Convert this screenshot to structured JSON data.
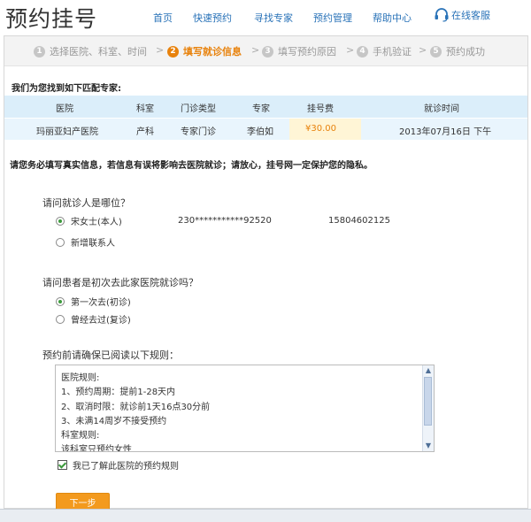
{
  "header": {
    "logo": "预约挂号",
    "nav": [
      "首页",
      "快速预约",
      "寻找专家",
      "预约管理",
      "帮助中心"
    ],
    "online": "在线客服"
  },
  "steps": [
    {
      "num": "1",
      "label": "选择医院、科室、时间"
    },
    {
      "num": "2",
      "label": "填写就诊信息"
    },
    {
      "num": "3",
      "label": "填写预约原因"
    },
    {
      "num": "4",
      "label": "手机验证"
    },
    {
      "num": "5",
      "label": "预约成功"
    }
  ],
  "step_arrow": ">",
  "found_title": "我们为您找到如下匹配专家:",
  "table": {
    "headers": [
      "医院",
      "科室",
      "门诊类型",
      "专家",
      "挂号费",
      "就诊时间"
    ],
    "row": [
      "玛丽亚妇产医院",
      "产科",
      "专家门诊",
      "李伯如",
      "¥30.00",
      "2013年07月16日 下午"
    ]
  },
  "notice": "请您务必填写真实信息，若信息有误将影响去医院就诊；请放心，挂号网一定保护您的隐私。",
  "patient": {
    "question": "请问就诊人是哪位？",
    "option1": "宋女士(本人)",
    "id_number": "230***********92520",
    "phone": "15804602125",
    "option2": "新增联系人"
  },
  "first_visit": {
    "question": "请问患者是初次去此家医院就诊吗？",
    "option1": "第一次去(初诊)",
    "option2": "曾经去过(复诊)"
  },
  "rules": {
    "title": "预约前请确保已阅读以下规则：",
    "lines": [
      "医院规则:",
      "1、预约周期：提前1-28天内",
      "2、取消时限：就诊前1天16点30分前",
      "3、未满14周岁不接受预约",
      "科室规则:",
      "该科室只预约女性"
    ]
  },
  "agree": "我已了解此医院的预约规则",
  "next_button": "下一步"
}
